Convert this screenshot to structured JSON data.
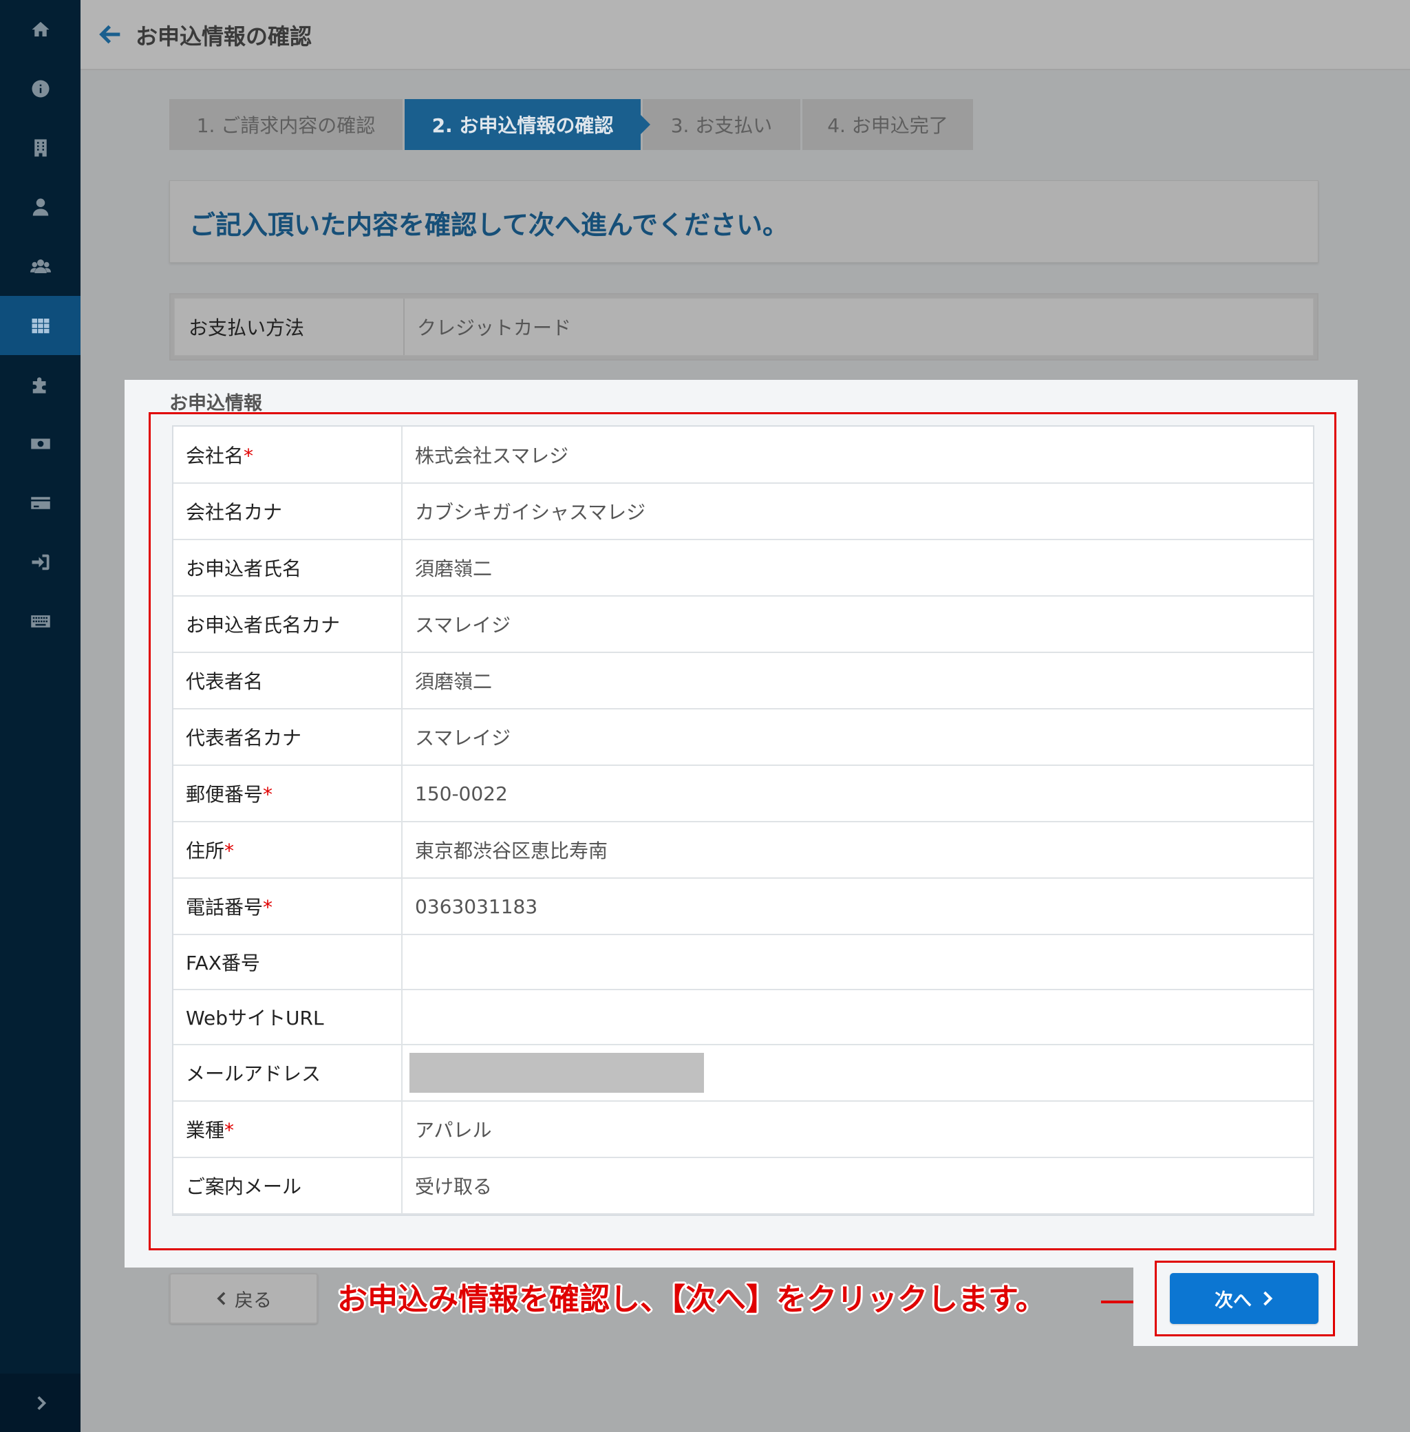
{
  "header": {
    "title": "お申込情報の確認"
  },
  "sidebar": {
    "items": [
      {
        "icon": "home-icon",
        "active": false
      },
      {
        "icon": "info-icon",
        "active": false
      },
      {
        "icon": "building-icon",
        "active": false
      },
      {
        "icon": "user-icon",
        "active": false
      },
      {
        "icon": "users-icon",
        "active": false
      },
      {
        "icon": "grid-icon",
        "active": true
      },
      {
        "icon": "puzzle-icon",
        "active": false
      },
      {
        "icon": "money-icon",
        "active": false
      },
      {
        "icon": "credit-card-icon",
        "active": false
      },
      {
        "icon": "sign-in-icon",
        "active": false
      },
      {
        "icon": "keyboard-icon",
        "active": false
      }
    ],
    "collapse_icon": "chevron-right-icon"
  },
  "steps": [
    {
      "label": "1. ご請求内容の確認",
      "active": false
    },
    {
      "label": "2. お申込情報の確認",
      "active": true
    },
    {
      "label": "3. お支払い",
      "active": false
    },
    {
      "label": "4. お申込完了",
      "active": false
    }
  ],
  "notice": {
    "text": "ご記入頂いた内容を確認して次へ進んでください。"
  },
  "payment": {
    "label": "お支払い方法",
    "value": "クレジットカード"
  },
  "info": {
    "heading": "お申込情報",
    "rows": [
      {
        "label": "会社名",
        "required": true,
        "value": "株式会社スマレジ"
      },
      {
        "label": "会社名カナ",
        "required": false,
        "value": "カブシキガイシャスマレジ"
      },
      {
        "label": "お申込者氏名",
        "required": false,
        "value": "須磨嶺二"
      },
      {
        "label": "お申込者氏名カナ",
        "required": false,
        "value": "スマレイジ"
      },
      {
        "label": "代表者名",
        "required": false,
        "value": "須磨嶺二"
      },
      {
        "label": "代表者名カナ",
        "required": false,
        "value": "スマレイジ"
      },
      {
        "label": "郵便番号",
        "required": true,
        "value": "150-0022"
      },
      {
        "label": "住所",
        "required": true,
        "value": "東京都渋谷区恵比寿南"
      },
      {
        "label": "電話番号",
        "required": true,
        "value": "0363031183"
      },
      {
        "label": "FAX番号",
        "required": false,
        "value": ""
      },
      {
        "label": "WebサイトURL",
        "required": false,
        "value": ""
      },
      {
        "label": "メールアドレス",
        "required": false,
        "value": "",
        "masked": true
      },
      {
        "label": "業種",
        "required": true,
        "value": "アパレル"
      },
      {
        "label": "ご案内メール",
        "required": false,
        "value": "受け取る"
      }
    ],
    "required_mark": "*"
  },
  "buttons": {
    "back_label": "戻る",
    "next_label": "次へ"
  },
  "annotation": {
    "text": "お申込み情報を確認し、【次へ】をクリックします。"
  },
  "colors": {
    "sidebar": "#031f33",
    "accent": "#1a5f8e",
    "primary_button": "#0c76d2",
    "annotation_red": "#e00000"
  }
}
